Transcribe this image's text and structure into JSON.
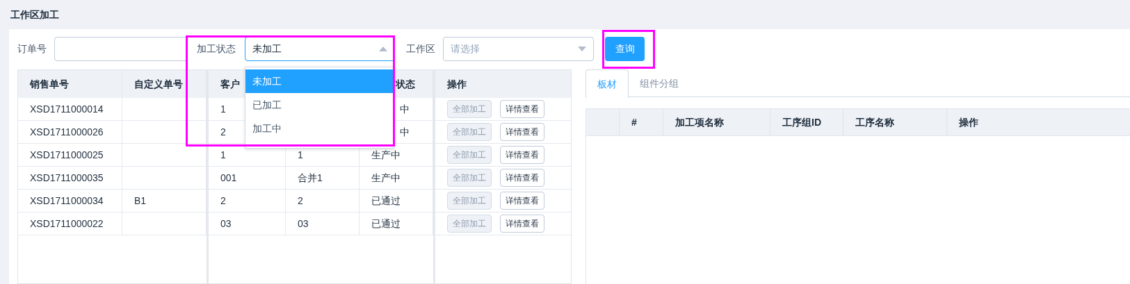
{
  "page": {
    "title": "工作区加工"
  },
  "filters": {
    "order_label": "订单号",
    "status_label": "加工状态",
    "status_value": "未加工",
    "status_open": true,
    "status_highlighted": true,
    "status_options": [
      {
        "label": "未加工",
        "selected": true
      },
      {
        "label": "已加工",
        "selected": false
      },
      {
        "label": "加工中",
        "selected": false
      }
    ],
    "area_label": "工作区",
    "area_placeholder": "请选择",
    "query_button": "查询",
    "query_highlighted": true
  },
  "orders": {
    "columns": [
      {
        "label": "销售单号"
      },
      {
        "label": "自定义单号"
      },
      {
        "label": "客户"
      },
      {},
      {
        "label": "状态",
        "clipped": true
      },
      {
        "label": "操作"
      }
    ],
    "rows": [
      {
        "sales_no": "XSD1711000014",
        "column_3": "1",
        "status": "中",
        "status_clipped": true,
        "process_all": "全部加工",
        "process_all_disabled": true,
        "details": "详情查看"
      },
      {
        "sales_no": "XSD1711000026",
        "column_3": "2",
        "status": "中",
        "status_clipped": true,
        "process_all": "全部加工",
        "process_all_disabled": true,
        "details": "详情查看"
      },
      {
        "sales_no": "XSD1711000025",
        "column_3": "1",
        "column_4": "1",
        "status": "生产中",
        "status_clipped": false,
        "process_all": "全部加工",
        "process_all_disabled": true,
        "details": "详情查看"
      },
      {
        "sales_no": "XSD1711000035",
        "column_3": "001",
        "column_4": "合并1",
        "status": "生产中",
        "status_clipped": false,
        "process_all": "全部加工",
        "process_all_disabled": true,
        "details": "详情查看"
      },
      {
        "sales_no": "XSD1711000034",
        "custom_no": "B1",
        "column_3": "2",
        "column_4": "2",
        "status": "已通过",
        "status_clipped": false,
        "process_all": "全部加工",
        "process_all_disabled": true,
        "details": "详情查看"
      },
      {
        "sales_no": "XSD1711000022",
        "column_3": "03",
        "column_4": "03",
        "status": "已通过",
        "status_clipped": false,
        "process_all": "全部加工",
        "process_all_disabled": true,
        "details": "详情查看"
      }
    ]
  },
  "detail": {
    "tabs": [
      {
        "label": "板材",
        "selected": true
      },
      {
        "label": "组件分组",
        "selected": false
      }
    ],
    "columns": [
      "#",
      "加工项名称",
      "工序组ID",
      "工序名称",
      "操作"
    ]
  }
}
